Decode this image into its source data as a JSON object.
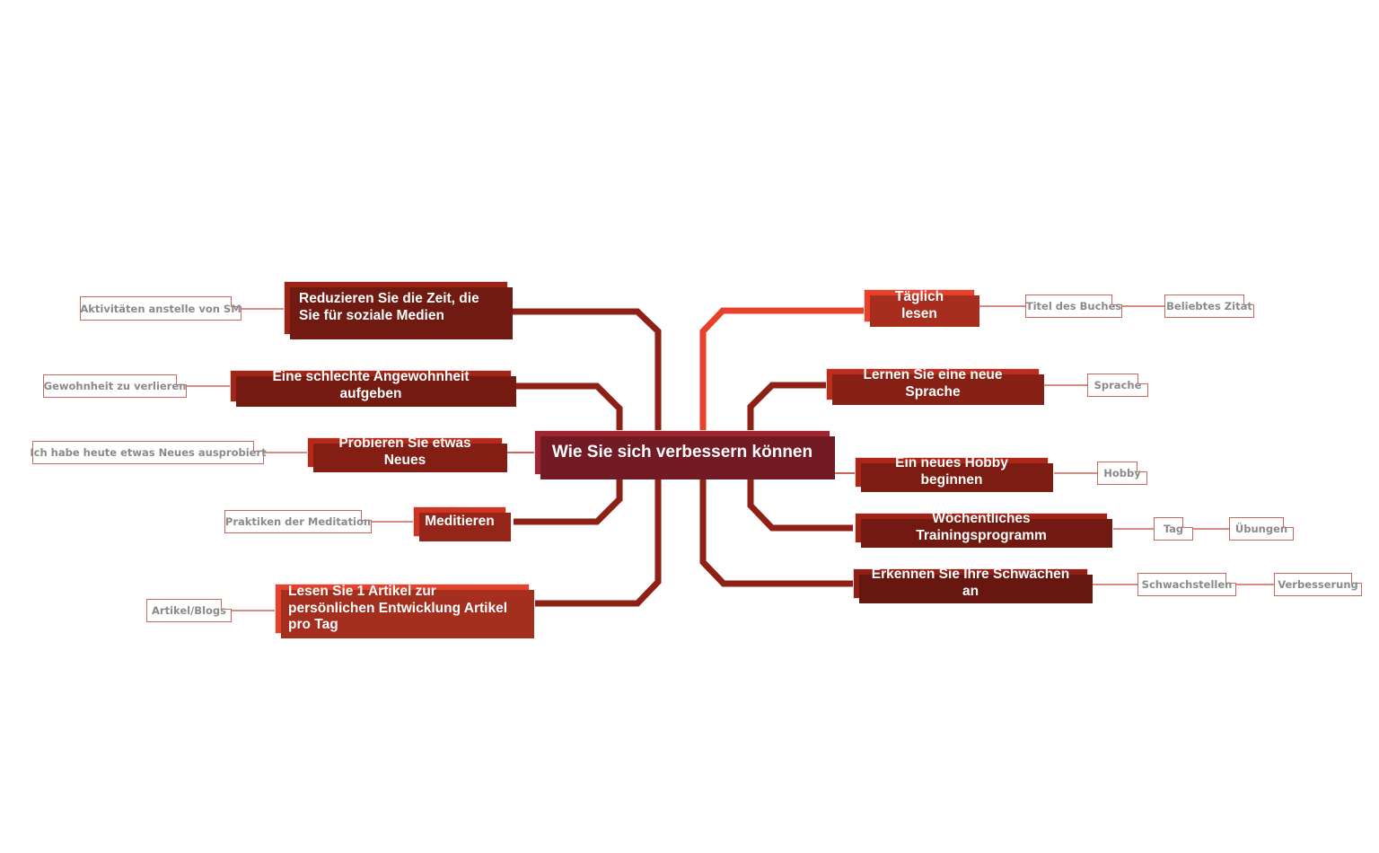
{
  "diagram": {
    "type": "mind-map",
    "title": "Wie Sie sich verbessern können",
    "background": "#ffffff",
    "palette": {
      "center": "#9e2633",
      "dark_brick": "#9c2417",
      "mid_brick": "#b52a1b",
      "bright_red": "#e5412b",
      "note_border": "#c9685c",
      "note_text": "#8a8a8a",
      "connector_dark": "#8e2015",
      "connector_bright": "#e8412b",
      "connector_thin": "#d98b7f"
    }
  },
  "center": {
    "label": "Wie Sie sich verbessern können"
  },
  "left_branches": [
    {
      "id": "social-media",
      "label": "Reduzieren Sie die Zeit, die Sie für soziale Medien",
      "color": "#9c2417",
      "notes": [
        {
          "label": "Aktivitäten anstelle von SM"
        }
      ]
    },
    {
      "id": "bad-habit",
      "label": "Eine schlechte Angewohnheit aufgeben",
      "color": "#a32518",
      "notes": [
        {
          "label": "Gewohnheit zu verlieren"
        }
      ]
    },
    {
      "id": "try-new",
      "label": "Probieren Sie etwas Neues",
      "color": "#b52a1b",
      "notes": [
        {
          "label": "Ich habe heute etwas Neues ausprobiert"
        }
      ]
    },
    {
      "id": "meditate",
      "label": "Meditieren",
      "color": "#cf3321",
      "notes": [
        {
          "label": "Praktiken der Meditation"
        }
      ]
    },
    {
      "id": "read-article",
      "label": "Lesen Sie 1 Artikel zur persönlichen Entwicklung Artikel pro Tag",
      "color": "#e5412b",
      "notes": [
        {
          "label": "Artikel/Blogs"
        }
      ]
    }
  ],
  "right_branches": [
    {
      "id": "daily-reading",
      "label": "Täglich lesen",
      "color": "#e8402a",
      "notes": [
        {
          "label": "Titel des Buches"
        },
        {
          "label": "Beliebtes Zitat"
        }
      ]
    },
    {
      "id": "new-language",
      "label": "Lernen Sie eine neue Sprache",
      "color": "#bc2d1d",
      "notes": [
        {
          "label": "Sprache"
        }
      ]
    },
    {
      "id": "new-hobby",
      "label": "Ein neues Hobby beginnen",
      "color": "#ad2719",
      "notes": [
        {
          "label": "Hobby"
        }
      ]
    },
    {
      "id": "training-program",
      "label": "Wöchentliches Trainingsprogramm",
      "color": "#9e2417",
      "notes": [
        {
          "label": "Tag"
        },
        {
          "label": "Übungen"
        }
      ]
    },
    {
      "id": "weaknesses",
      "label": "Erkennen Sie Ihre Schwächen an",
      "color": "#8f2015",
      "notes": [
        {
          "label": "Schwachstellen"
        },
        {
          "label": "Verbesserung"
        }
      ]
    }
  ]
}
